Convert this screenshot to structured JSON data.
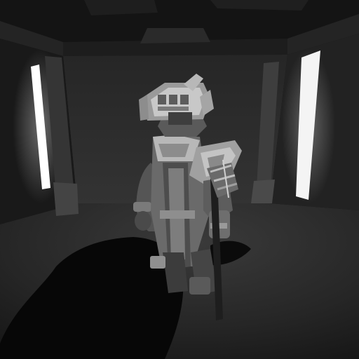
{
  "scene": {
    "colors": {
      "ceiling": "#151515",
      "back_wall": "#2e2e2e",
      "left_wall": "#1a1a1a",
      "right_wall": "#222222",
      "floor": "#2b2b2b",
      "shadow": "#060606",
      "pillar": "#3c3c3c",
      "light_strip": "#ffffff",
      "armor_light": "#a8a8a8",
      "armor_mid": "#6e6e6e",
      "armor_dark": "#3a3a3a"
    },
    "icons": [
      "armored-warrior-character",
      "ceiling-beams",
      "light-window-left",
      "light-window-right"
    ]
  }
}
